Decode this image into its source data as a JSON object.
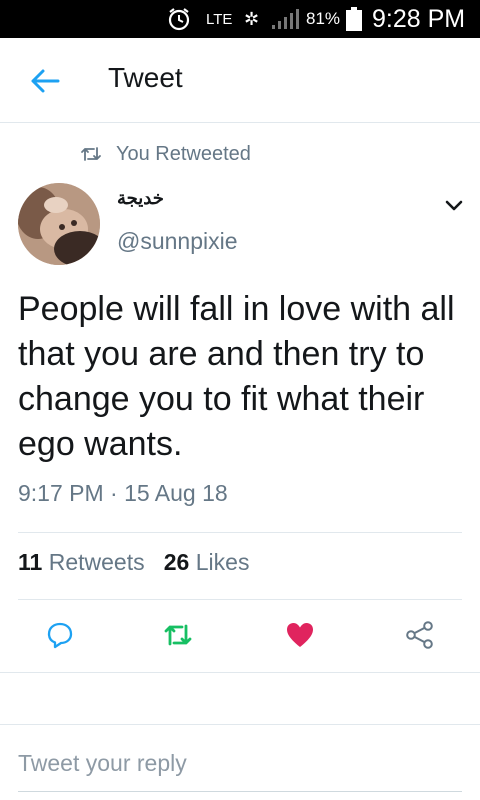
{
  "status_bar": {
    "network": "LTE",
    "battery": "81%",
    "time": "9:28 PM",
    "icons": [
      "alarm-icon",
      "data-activity-icon",
      "signal-icon",
      "battery-icon"
    ]
  },
  "header": {
    "title": "Tweet",
    "back_icon": "arrow-left-icon"
  },
  "retweet_label": "You Retweeted",
  "author": {
    "name": "خديجة",
    "handle": "@sunnpixie"
  },
  "tweet": {
    "text": "People will fall in love with all that you are and then try to change you to fit what their ego wants.",
    "timestamp": "9:17 PM · 15 Aug 18"
  },
  "stats": {
    "retweets_count": "11",
    "retweets_label": "Retweets",
    "likes_count": "26",
    "likes_label": "Likes"
  },
  "actions": [
    "reply-icon",
    "retweet-icon",
    "heart-icon",
    "share-icon"
  ],
  "reply": {
    "placeholder": "Tweet your reply"
  },
  "colors": {
    "accent": "#1da1f2",
    "retweet_green": "#17bf63",
    "like_red": "#e0245e",
    "secondary_text": "#657786"
  }
}
